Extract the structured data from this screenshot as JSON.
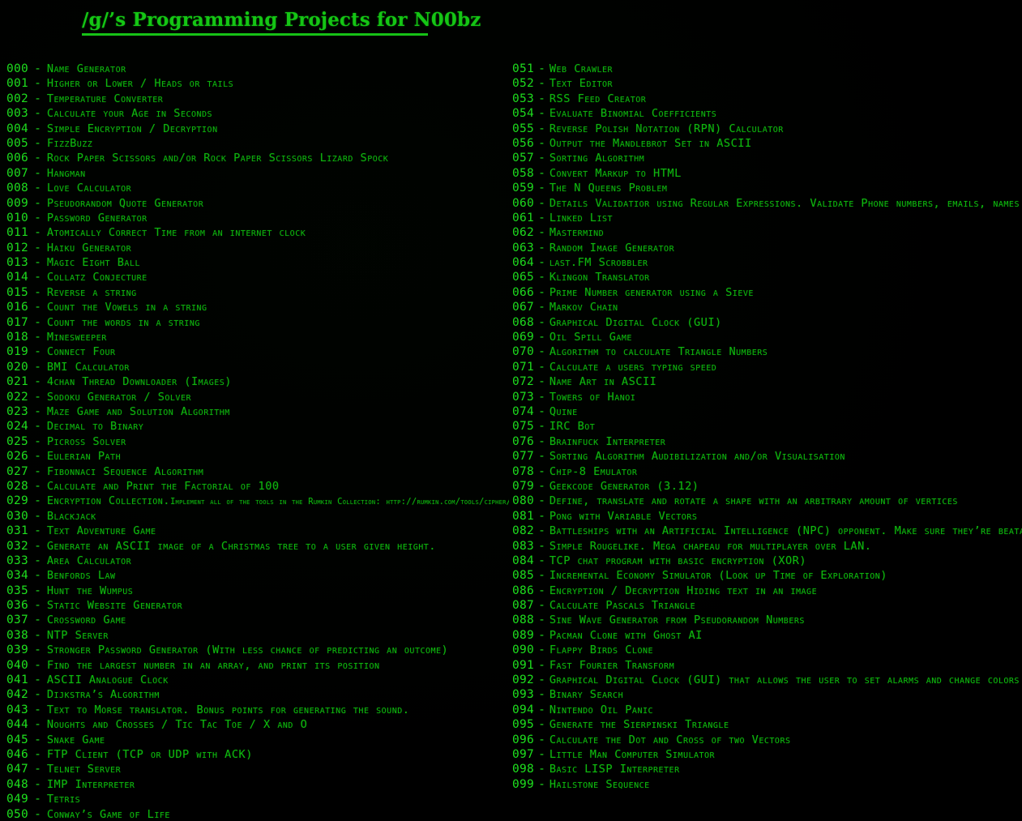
{
  "page": {
    "title": "/g/’s Programming Projects for N00bz",
    "background_color": "#000000",
    "number_color": "#1ee01e",
    "label_color": "#0fb70f",
    "title_color": "#15ca15",
    "rule_color": "#17c617"
  },
  "columns": {
    "left": [
      {
        "num": "000",
        "dash": "-",
        "label": "Name Generator"
      },
      {
        "num": "001",
        "dash": "-",
        "label": "Higher or Lower / Heads or tails"
      },
      {
        "num": "002",
        "dash": "-",
        "label": "Temperature Converter"
      },
      {
        "num": "003",
        "dash": "-",
        "label": "Calculate your Age in Seconds"
      },
      {
        "num": "004",
        "dash": "-",
        "label": "Simple Encryption / Decryption"
      },
      {
        "num": "005",
        "dash": "-",
        "label": "FizzBuzz"
      },
      {
        "num": "006",
        "dash": "-",
        "label": "Rock Paper Scissors and/or Rock Paper Scissors Lizard Spock"
      },
      {
        "num": "007",
        "dash": "-",
        "label": "Hangman"
      },
      {
        "num": "008",
        "dash": "-",
        "label": "Love Calculator"
      },
      {
        "num": "009",
        "dash": "-",
        "label": "Pseudorandom Quote Generator"
      },
      {
        "num": "010",
        "dash": "-",
        "label": "Password Generator"
      },
      {
        "num": "011",
        "dash": "-",
        "label": "Atomically Correct Time from an internet clock"
      },
      {
        "num": "012",
        "dash": "-",
        "label": "Haiku Generator"
      },
      {
        "num": "013",
        "dash": "-",
        "label": "Magic Eight Ball"
      },
      {
        "num": "014",
        "dash": "-",
        "label": "Collatz Conjecture"
      },
      {
        "num": "015",
        "dash": "-",
        "label": "Reverse a string"
      },
      {
        "num": "016",
        "dash": "-",
        "label": "Count the Vowels in a string"
      },
      {
        "num": "017",
        "dash": "-",
        "label": "Count the words in a string"
      },
      {
        "num": "018",
        "dash": "-",
        "label": "Minesweeper"
      },
      {
        "num": "019",
        "dash": "-",
        "label": "Connect Four"
      },
      {
        "num": "020",
        "dash": "-",
        "label": "BMI Calculator"
      },
      {
        "num": "021",
        "dash": "-",
        "label": "4chan Thread Downloader (Images)"
      },
      {
        "num": "022",
        "dash": "-",
        "label": "Sodoku Generator / Solver"
      },
      {
        "num": "023",
        "dash": "-",
        "label": "Maze Game and Solution Algorithm"
      },
      {
        "num": "024",
        "dash": "-",
        "label": "Decimal to Binary"
      },
      {
        "num": "025",
        "dash": "-",
        "label": "Picross Solver"
      },
      {
        "num": "026",
        "dash": "-",
        "label": "Eulerian Path"
      },
      {
        "num": "027",
        "dash": "-",
        "label": "Fibonnaci Sequence Algorithm"
      },
      {
        "num": "028",
        "dash": "-",
        "label": "Calculate and Print the Factorial of 100"
      },
      {
        "num": "029",
        "dash": "-",
        "label": "Encryption Collection.",
        "label_small": "Implement all of the tools in the Rumkin Collection: http://rumkin.com/tools/cipher/"
      },
      {
        "num": "030",
        "dash": "-",
        "label": "Blackjack"
      },
      {
        "num": "031",
        "dash": "-",
        "label": "Text Adventure Game"
      },
      {
        "num": "032",
        "dash": "-",
        "label": "Generate an ASCII image of a Christmas tree to a user given height."
      },
      {
        "num": "033",
        "dash": "-",
        "label": "Area Calculator"
      },
      {
        "num": "034",
        "dash": "-",
        "label": "Benfords Law"
      },
      {
        "num": "035",
        "dash": "-",
        "label": "Hunt the Wumpus"
      },
      {
        "num": "036",
        "dash": "-",
        "label": "Static Website Generator"
      },
      {
        "num": "037",
        "dash": "-",
        "label": "Crossword Game"
      },
      {
        "num": "038",
        "dash": "-",
        "label": "NTP Server"
      },
      {
        "num": "039",
        "dash": "-",
        "label": "Stronger Password Generator (With less chance of predicting an outcome)"
      },
      {
        "num": "040",
        "dash": "-",
        "label": "Find the largest number in an array, and print its position"
      },
      {
        "num": "041",
        "dash": "-",
        "label": "ASCII Analogue Clock"
      },
      {
        "num": "042",
        "dash": "-",
        "label": "Dijkstra’s Algorithm"
      },
      {
        "num": "043",
        "dash": "-",
        "label": "Text to Morse translator. Bonus points for generating the sound."
      },
      {
        "num": "044",
        "dash": "-",
        "label": "Noughts and Crosses / Tic Tac Toe / X and O"
      },
      {
        "num": "045",
        "dash": "-",
        "label": "Snake Game"
      },
      {
        "num": "046",
        "dash": "-",
        "label": "FTP Client (TCP or UDP with ACK)"
      },
      {
        "num": "047",
        "dash": "-",
        "label": "Telnet Server"
      },
      {
        "num": "048",
        "dash": "-",
        "label": "IMP Interpreter"
      },
      {
        "num": "049",
        "dash": "-",
        "label": "Tetris"
      },
      {
        "num": "050",
        "dash": "-",
        "label": "Conway’s Game of Life"
      }
    ],
    "right": [
      {
        "num": "051",
        "dash": "-",
        "label": "Web Crawler"
      },
      {
        "num": "052",
        "dash": "-",
        "label": "Text Editor"
      },
      {
        "num": "053",
        "dash": "-",
        "label": "RSS Feed Creator"
      },
      {
        "num": "054",
        "dash": "-",
        "label": "Evaluate Binomial Coefficients"
      },
      {
        "num": "055",
        "dash": "-",
        "label": "Reverse Polish Notation (RPN) Calculator"
      },
      {
        "num": "056",
        "dash": "-",
        "label": "Output the Mandlebrot Set in ASCII"
      },
      {
        "num": "057",
        "dash": "-",
        "label": "Sorting Algorithm"
      },
      {
        "num": "058",
        "dash": "-",
        "label": "Convert Markup to HTML"
      },
      {
        "num": "059",
        "dash": "-",
        "label": "The N Queens Problem"
      },
      {
        "num": "060",
        "dash": "-",
        "label": "Details Validatior using Regular Expressions. Validate Phone numbers, emails, names etc."
      },
      {
        "num": "061",
        "dash": "-",
        "label": "Linked List"
      },
      {
        "num": "062",
        "dash": "-",
        "label": "Mastermind"
      },
      {
        "num": "063",
        "dash": "-",
        "label": "Random Image Generator"
      },
      {
        "num": "064",
        "dash": "-",
        "label": "last.FM Scrobbler"
      },
      {
        "num": "065",
        "dash": "-",
        "label": "Klingon Translator"
      },
      {
        "num": "066",
        "dash": "-",
        "label": "Prime Number generator using a Sieve"
      },
      {
        "num": "067",
        "dash": "-",
        "label": "Markov Chain"
      },
      {
        "num": "068",
        "dash": "-",
        "label": "Graphical Digital Clock (GUI)"
      },
      {
        "num": "069",
        "dash": "-",
        "label": "Oil Spill Game"
      },
      {
        "num": "070",
        "dash": "-",
        "label": "Algorithm to calculate Triangle Numbers"
      },
      {
        "num": "071",
        "dash": "-",
        "label": "Calculate a users typing speed"
      },
      {
        "num": "072",
        "dash": "-",
        "label": "Name Art in ASCII"
      },
      {
        "num": "073",
        "dash": "-",
        "label": "Towers of Hanoi"
      },
      {
        "num": "074",
        "dash": "-",
        "label": "Quine"
      },
      {
        "num": "075",
        "dash": "-",
        "label": "IRC Bot"
      },
      {
        "num": "076",
        "dash": "-",
        "label": "Brainfuck Interpreter"
      },
      {
        "num": "077",
        "dash": "-",
        "label": "Sorting Algorithm Audibilization and/or Visualisation"
      },
      {
        "num": "078",
        "dash": "-",
        "label": "Chip-8 Emulator"
      },
      {
        "num": "079",
        "dash": "-",
        "label": "Geekcode Generator (3.12)"
      },
      {
        "num": "080",
        "dash": "-",
        "label": "Define, translate and rotate a shape with an arbitrary amount of vertices"
      },
      {
        "num": "081",
        "dash": "-",
        "label": "Pong with Variable Vectors"
      },
      {
        "num": "082",
        "dash": "-",
        "label": "Battleships with an Artificial Intelligence (NPC) opponent. Make sure they’re beatable"
      },
      {
        "num": "083",
        "dash": "-",
        "label": "Simple Rougelike. Mega chapeau for multiplayer over LAN."
      },
      {
        "num": "084",
        "dash": "-",
        "label": "TCP chat program with basic encryption (XOR)"
      },
      {
        "num": "085",
        "dash": "-",
        "label": "Incremental Economy Simulator (Look up Time of Exploration)"
      },
      {
        "num": "086",
        "dash": "-",
        "label": "Encryption / Decryption Hiding text in an image"
      },
      {
        "num": "087",
        "dash": "-",
        "label": "Calculate Pascals Triangle"
      },
      {
        "num": "088",
        "dash": "-",
        "label": "Sine Wave Generator from Pseudorandom Numbers"
      },
      {
        "num": "089",
        "dash": "-",
        "label": "Pacman Clone with Ghost AI"
      },
      {
        "num": "090",
        "dash": "-",
        "label": "Flappy Birds Clone"
      },
      {
        "num": "091",
        "dash": "-",
        "label": "Fast Fourier Transform"
      },
      {
        "num": "092",
        "dash": "-",
        "label": "Graphical Digital Clock (GUI) that allows the user to set alarms and change colors"
      },
      {
        "num": "093",
        "dash": "-",
        "label": "Binary Search"
      },
      {
        "num": "094",
        "dash": "-",
        "label": "Nintendo Oil Panic"
      },
      {
        "num": "095",
        "dash": "-",
        "label": "Generate the Sierpinski Triangle"
      },
      {
        "num": "096",
        "dash": "-",
        "label": "Calculate the Dot and Cross of two Vectors"
      },
      {
        "num": "097",
        "dash": "-",
        "label": "Little Man Computer Simulator"
      },
      {
        "num": "098",
        "dash": "-",
        "label": "Basic LISP Interpreter"
      },
      {
        "num": "099",
        "dash": "-",
        "label": "Hailstone Sequence"
      }
    ]
  }
}
